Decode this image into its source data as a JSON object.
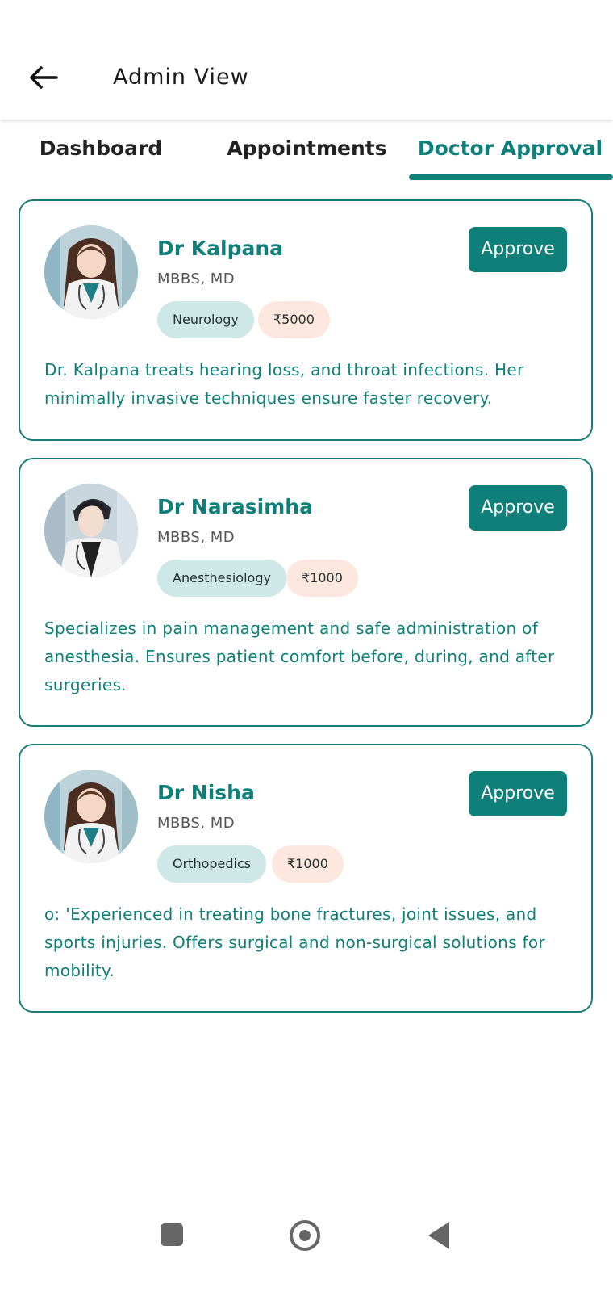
{
  "header": {
    "title": "Admin View",
    "back_icon": "arrow-left-icon"
  },
  "tabs": [
    {
      "label": "Dashboard",
      "active": false
    },
    {
      "label": "Appointments",
      "active": false
    },
    {
      "label": "Doctor Approval",
      "active": true
    }
  ],
  "colors": {
    "accent": "#0f7f7a",
    "specialty_tag_bg": "#cde8e6",
    "fee_tag_bg": "#fde7df"
  },
  "doctors": [
    {
      "name": "Dr Kalpana",
      "degree": "MBBS, MD",
      "specialty": "Neurology",
      "fee": "₹5000",
      "description": "Dr. Kalpana treats hearing loss, and throat infections. Her minimally invasive techniques ensure faster recovery.",
      "approve_label": "Approve",
      "avatar": "female-doctor-avatar"
    },
    {
      "name": "Dr Narasimha",
      "degree": "MBBS, MD",
      "specialty": "Anesthesiology",
      "fee": "₹1000",
      "description": "Specializes in pain management and safe administration of anesthesia. Ensures patient comfort before, during, and after surgeries.",
      "approve_label": "Approve",
      "avatar": "male-doctor-avatar"
    },
    {
      "name": "Dr Nisha",
      "degree": "MBBS, MD",
      "specialty": "Orthopedics",
      "fee": "₹1000",
      "description": "o: 'Experienced in treating bone fractures, joint issues, and sports injuries. Offers surgical and non-surgical solutions for mobility.",
      "approve_label": "Approve",
      "avatar": "female-doctor-avatar"
    }
  ],
  "navbar": {
    "icons": [
      "recent-apps-icon",
      "home-icon",
      "back-triangle-icon"
    ]
  }
}
